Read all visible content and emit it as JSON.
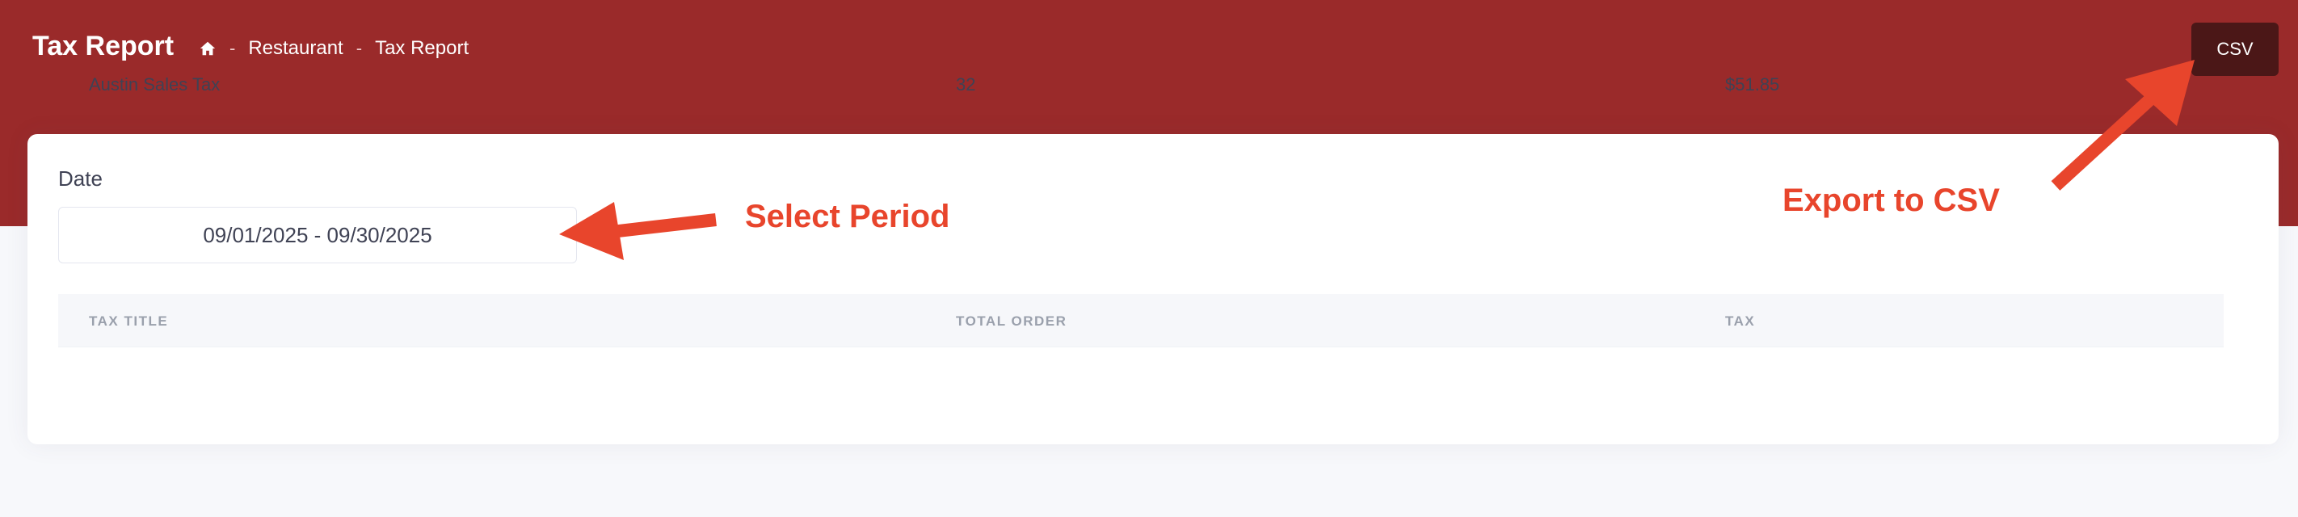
{
  "header": {
    "title": "Tax Report",
    "breadcrumb": [
      "Restaurant",
      "Tax Report"
    ],
    "breadcrumb_separator": "-",
    "csv_button_label": "CSV"
  },
  "filter": {
    "date_label": "Date",
    "date_value": "09/01/2025 - 09/30/2025"
  },
  "table": {
    "columns": [
      "TAX TITLE",
      "TOTAL ORDER",
      "TAX"
    ],
    "rows": [
      {
        "tax_title": "Austin Sales Tax",
        "total_order": "32",
        "tax": "$51.85"
      }
    ]
  },
  "annotations": {
    "select_period": "Select Period",
    "export_csv": "Export to CSV",
    "color": "#e8452c"
  },
  "colors": {
    "header_bg": "#9a2a2a",
    "csv_button_bg": "#4b1717"
  },
  "icons": {
    "home": "home-icon"
  }
}
